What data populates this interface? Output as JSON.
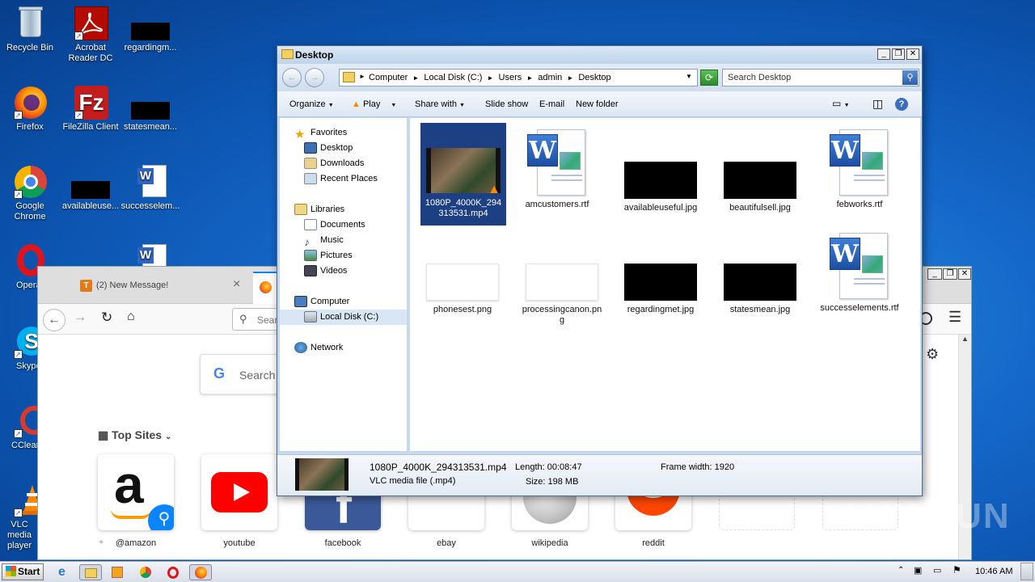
{
  "desktop": {
    "icons": [
      {
        "label": "Recycle Bin"
      },
      {
        "label": "Acrobat Reader DC"
      },
      {
        "label": "regardingm..."
      },
      {
        "label": "Firefox"
      },
      {
        "label": "FileZilla Client"
      },
      {
        "label": "statesmean..."
      },
      {
        "label": "Google Chrome"
      },
      {
        "label": "availableuse..."
      },
      {
        "label": "successelem..."
      },
      {
        "label": "Opera"
      },
      {
        "label": "Skype"
      },
      {
        "label": "CCleaner"
      },
      {
        "label": "VLC media player"
      }
    ]
  },
  "firefox": {
    "tab_title": "(2) New Message!",
    "url_placeholder": "Sear",
    "search_placeholder": "Search",
    "top_sites_label": "Top Sites",
    "tiles": [
      {
        "label": "@amazon"
      },
      {
        "label": "youtube"
      },
      {
        "label": "facebook"
      },
      {
        "label": "ebay"
      },
      {
        "label": "wikipedia"
      },
      {
        "label": "reddit"
      }
    ]
  },
  "explorer": {
    "title": "Desktop",
    "breadcrumb": [
      "Computer",
      "Local Disk (C:)",
      "Users",
      "admin",
      "Desktop"
    ],
    "search_placeholder": "Search Desktop",
    "toolbar": {
      "organize": "Organize",
      "play": "Play",
      "share_with": "Share with",
      "slide_show": "Slide show",
      "email": "E-mail",
      "new_folder": "New folder"
    },
    "nav": {
      "favorites": "Favorites",
      "desktop": "Desktop",
      "downloads": "Downloads",
      "recent_places": "Recent Places",
      "libraries": "Libraries",
      "documents": "Documents",
      "music": "Music",
      "pictures": "Pictures",
      "videos": "Videos",
      "computer": "Computer",
      "local_disk": "Local Disk (C:)",
      "network": "Network"
    },
    "files": [
      {
        "name": "1080P_4000K_294313531.mp4",
        "kind": "video",
        "selected": true
      },
      {
        "name": "amcustomers.rtf",
        "kind": "word"
      },
      {
        "name": "availableuseful.jpg",
        "kind": "black"
      },
      {
        "name": "beautifulsell.jpg",
        "kind": "black"
      },
      {
        "name": "febworks.rtf",
        "kind": "word"
      },
      {
        "name": "phonesest.png",
        "kind": "white"
      },
      {
        "name": "processingcanon.png",
        "kind": "white"
      },
      {
        "name": "regardingmet.jpg",
        "kind": "black"
      },
      {
        "name": "statesmean.jpg",
        "kind": "black"
      },
      {
        "name": "successelements.rtf",
        "kind": "word"
      }
    ],
    "details": {
      "filename": "1080P_4000K_294313531.mp4",
      "type": "VLC media file (.mp4)",
      "length": "Length: 00:08:47",
      "size": "Size: 198 MB",
      "frame_width": "Frame width: 1920"
    }
  },
  "taskbar": {
    "start": "Start",
    "time": "10:46 AM"
  },
  "watermark": "ANY RUN"
}
